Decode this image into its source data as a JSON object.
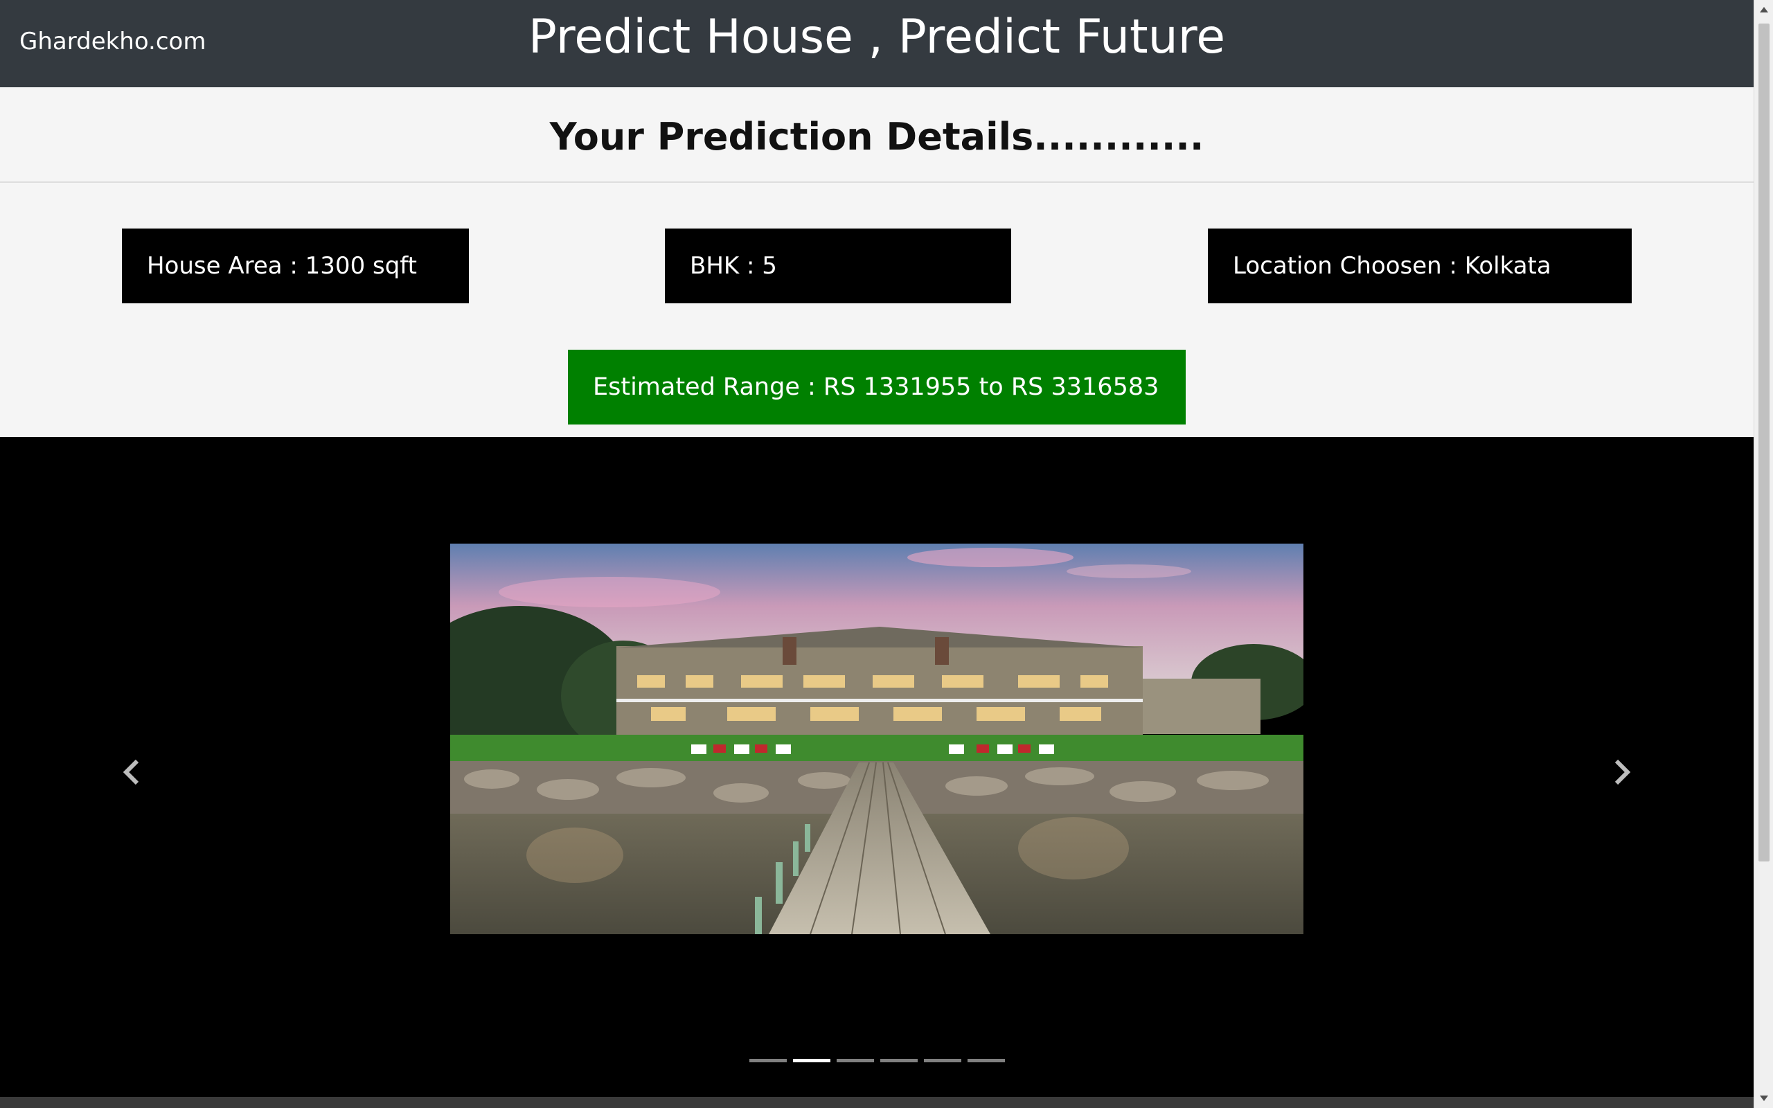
{
  "navbar": {
    "brand": "Ghardekho.com",
    "title": "Predict House , Predict Future"
  },
  "details": {
    "heading": "Your Prediction Details............",
    "house_area": "House Area : 1300 sqft",
    "bhk": "BHK : 5",
    "location": "Location Choosen : Kolkata",
    "estimate": "Estimated Range : RS 1331955 to RS 3316583"
  },
  "carousel": {
    "prev_icon": "chevron-left-icon",
    "next_icon": "chevron-right-icon",
    "slide_count": 6,
    "active_index": 1
  },
  "colors": {
    "navbar": "#343a40",
    "info_box": "#000000",
    "estimate_box": "#008000",
    "carousel_bg": "#000000"
  }
}
